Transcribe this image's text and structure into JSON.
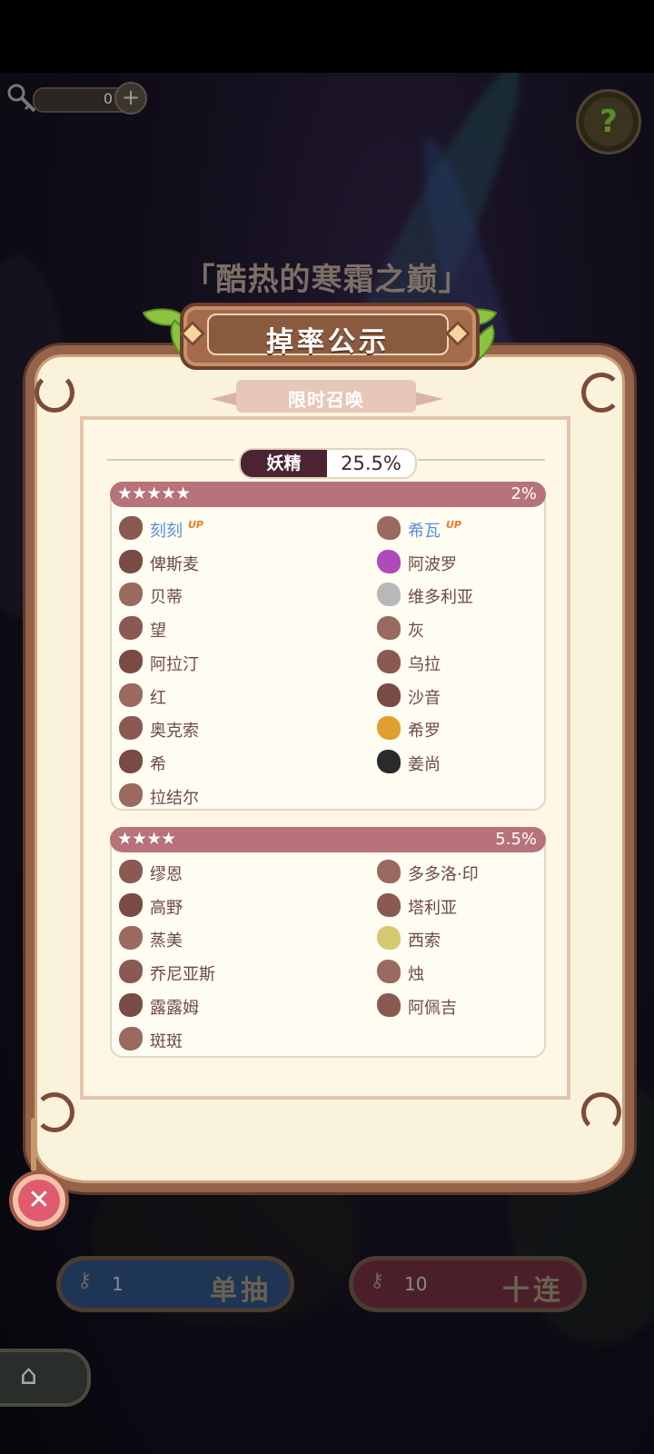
{
  "top_bar": {
    "key_count": "0",
    "plus": "+",
    "help": "?"
  },
  "banner_title": "「酷热的寒霜之巅」",
  "panel": {
    "title": "掉率公示",
    "subtitle": "限时召唤",
    "category": {
      "name": "妖精",
      "rate": "25.5%"
    },
    "tiers": [
      {
        "stars": "★★★★★",
        "rate": "2%",
        "items": [
          {
            "name": "刻刻",
            "up": "UP",
            "icon": "bead-chain-icon"
          },
          {
            "name": "希瓦",
            "up": "UP",
            "icon": "shell-icon"
          },
          {
            "name": "俾斯麦",
            "icon": "cloud-icon"
          },
          {
            "name": "阿波罗",
            "icon": "purple-disc-icon"
          },
          {
            "name": "贝蒂",
            "icon": "scissors-icon"
          },
          {
            "name": "维多利亚",
            "icon": "plate-icon"
          },
          {
            "name": "望",
            "icon": "scroll-icon"
          },
          {
            "name": "灰",
            "icon": "pouch-icon"
          },
          {
            "name": "阿拉汀",
            "icon": "lamp-icon"
          },
          {
            "name": "乌拉",
            "icon": "bottle-icon"
          },
          {
            "name": "红",
            "icon": "basket-icon"
          },
          {
            "name": "沙音",
            "icon": "cage-icon"
          },
          {
            "name": "奥克索",
            "icon": "swirl-icon"
          },
          {
            "name": "希罗",
            "icon": "crown-icon"
          },
          {
            "name": "希",
            "icon": "key-icon"
          },
          {
            "name": "姜尚",
            "icon": "yin-yang-icon"
          },
          {
            "name": "拉结尔",
            "icon": "feather-icon"
          }
        ]
      },
      {
        "stars": "★★★★",
        "rate": "5.5%",
        "items": [
          {
            "name": "缪恩",
            "icon": "chess-piece-icon"
          },
          {
            "name": "多多洛·印",
            "icon": "ladle-icon"
          },
          {
            "name": "高野",
            "icon": "hammer-icon"
          },
          {
            "name": "塔利亚",
            "icon": "knife-icon"
          },
          {
            "name": "蒸美",
            "icon": "bun-icon"
          },
          {
            "name": "西索",
            "icon": "tape-roll-icon"
          },
          {
            "name": "乔尼亚斯",
            "icon": "flower-icon"
          },
          {
            "name": "烛",
            "icon": "candle-icon"
          },
          {
            "name": "露露姆",
            "icon": "test-tube-icon"
          },
          {
            "name": "阿佩吉",
            "icon": "glasses-icon"
          },
          {
            "name": "斑斑",
            "icon": "drum-icon"
          }
        ]
      }
    ]
  },
  "close_button": "✕",
  "draw_buttons": [
    {
      "cost": "1",
      "label": "单抽",
      "color": "#1f3556"
    },
    {
      "cost": "10",
      "label": "十连",
      "color": "#4a1f2a"
    }
  ],
  "home_icon": "⌂",
  "colors": {
    "panel_bg": "#fbf2dc",
    "tier_header": "#b8727a",
    "up_name": "#5a8fd6",
    "up_badge": "#f07a2a",
    "category_dark": "#4c2333"
  }
}
